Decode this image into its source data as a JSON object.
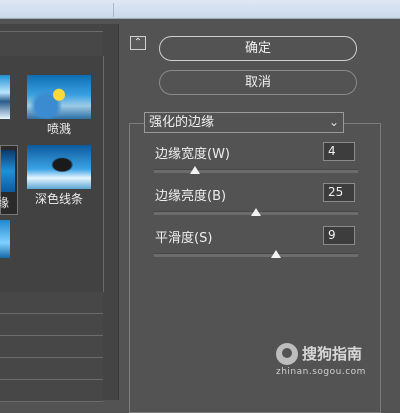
{
  "dialog": {
    "ok_label": "确定",
    "cancel_label": "取消",
    "collapse_glyph": "⌃"
  },
  "gallery": {
    "items": [
      {
        "label": "喷溅",
        "icon": "spray-filter-thumbnail"
      },
      {
        "label": "缘",
        "icon": "accented-edges-thumbnail",
        "selected": true
      },
      {
        "label": "深色线条",
        "icon": "dark-strokes-thumbnail"
      }
    ]
  },
  "filter": {
    "selected": "强化的边缘",
    "params": [
      {
        "label": "边缘宽度(W)",
        "value": "4",
        "fraction": 0.2
      },
      {
        "label": "边缘亮度(B)",
        "value": "25",
        "fraction": 0.5
      },
      {
        "label": "平滑度(S)",
        "value": "9",
        "fraction": 0.6
      }
    ]
  },
  "watermark": {
    "brand": "搜狗指南",
    "url": "zhinan.sogou.com"
  }
}
